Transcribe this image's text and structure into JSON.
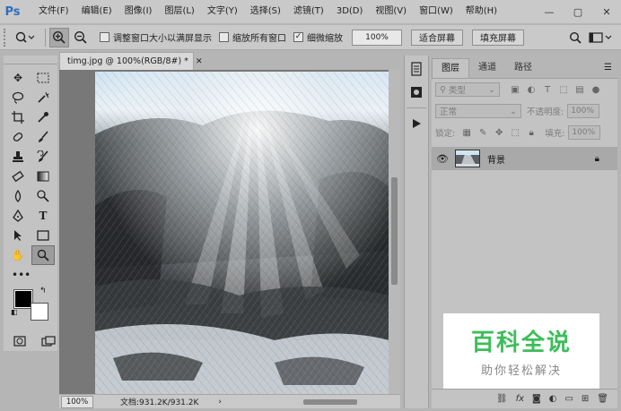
{
  "app": {
    "logo": "Ps"
  },
  "menu": [
    "文件(F)",
    "编辑(E)",
    "图像(I)",
    "图层(L)",
    "文字(Y)",
    "选择(S)",
    "滤镜(T)",
    "3D(D)",
    "视图(V)",
    "窗口(W)",
    "帮助(H)"
  ],
  "window_controls": {
    "minimize": "—",
    "maximize": "▢",
    "close": "✕"
  },
  "options": {
    "tool_icon": "zoom-tool-icon",
    "resize_windows_label": "调整窗口大小以满屏显示",
    "resize_windows_checked": false,
    "zoom_all_label": "缩放所有窗口",
    "zoom_all_checked": false,
    "scrubby_label": "细微缩放",
    "scrubby_checked": true,
    "zoom_value": "100%",
    "fit_screen_label": "适合屏幕",
    "fill_screen_label": "填充屏幕"
  },
  "document": {
    "tab_title": "timg.jpg @ 100%(RGB/8#) *",
    "zoom": "100%",
    "info": "文档:931.2K/931.2K"
  },
  "layers_panel": {
    "tabs": [
      "图层",
      "通道",
      "路径"
    ],
    "active_tab": 0,
    "filter_placeholder": "类型",
    "blend_mode": "正常",
    "opacity_label": "不透明度:",
    "opacity_value": "100%",
    "lock_label": "锁定:",
    "fill_label": "填充:",
    "fill_value": "100%",
    "layers": [
      {
        "name": "背景",
        "visible": true,
        "locked": true
      }
    ]
  },
  "watermark": {
    "main": "百科全说",
    "sub": "助你轻松解决"
  },
  "colors": {
    "foreground": "#000000",
    "background": "#ffffff",
    "accent": "#2f6dbf",
    "watermark_green": "#3dbd5a"
  }
}
